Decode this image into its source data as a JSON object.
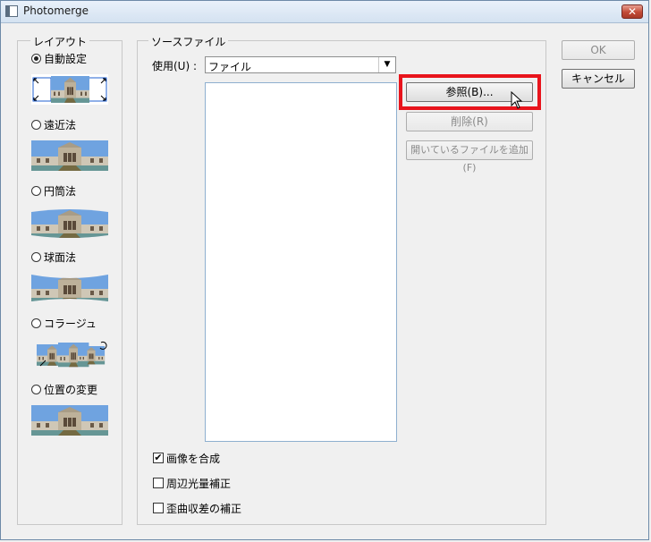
{
  "window": {
    "title": "Photomerge",
    "close_label": "✕"
  },
  "layout_group": {
    "legend": "レイアウト",
    "options": [
      {
        "label": "自動設定",
        "checked": true,
        "thumb": "auto-panorama-thumbnail"
      },
      {
        "label": "遠近法",
        "checked": false,
        "thumb": "perspective-thumbnail"
      },
      {
        "label": "円筒法",
        "checked": false,
        "thumb": "cylindrical-thumbnail"
      },
      {
        "label": "球面法",
        "checked": false,
        "thumb": "spherical-thumbnail"
      },
      {
        "label": "コラージュ",
        "checked": false,
        "thumb": "collage-thumbnail"
      },
      {
        "label": "位置の変更",
        "checked": false,
        "thumb": "reposition-thumbnail"
      }
    ]
  },
  "source_group": {
    "legend": "ソースファイル",
    "use_label": "使用(U) :",
    "use_value": "ファイル",
    "buttons": {
      "browse": "参照(B)...",
      "remove": "削除(R)",
      "add_open": "開いているファイルを追加(F)"
    },
    "checkboxes": [
      {
        "label": "画像を合成",
        "checked": true,
        "mark": "✔"
      },
      {
        "label": "周辺光量補正",
        "checked": false,
        "mark": ""
      },
      {
        "label": "歪曲収差の補正",
        "checked": false,
        "mark": ""
      }
    ]
  },
  "actions": {
    "ok": "OK",
    "cancel": "キャンセル"
  },
  "colors": {
    "highlight": "#e8141c"
  }
}
